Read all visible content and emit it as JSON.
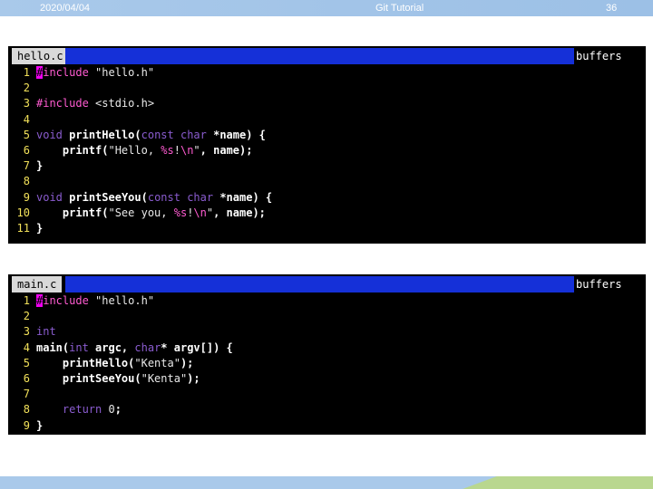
{
  "header": {
    "date": "2020/04/04",
    "title": "Git Tutorial",
    "page": "36"
  },
  "editors": [
    {
      "tab": "hello.c",
      "side": "buffers",
      "lines": [
        [
          {
            "t": "#",
            "c": "cursor"
          },
          {
            "t": "include",
            "c": "pp"
          },
          {
            "t": " \"hello.h\"",
            "c": "str"
          }
        ],
        [],
        [
          {
            "t": "#include",
            "c": "pp"
          },
          {
            "t": " <stdio.h>",
            "c": "str"
          }
        ],
        [],
        [
          {
            "t": "void",
            "c": "ty"
          },
          {
            "t": " ",
            "c": ""
          },
          {
            "t": "printHello",
            "c": "fn"
          },
          {
            "t": "(",
            "c": "fn"
          },
          {
            "t": "const char",
            "c": "ty"
          },
          {
            "t": " *name) {",
            "c": "fn"
          }
        ],
        [
          {
            "t": "    printf(",
            "c": "fn"
          },
          {
            "t": "\"Hello, ",
            "c": "str"
          },
          {
            "t": "%s",
            "c": "pp"
          },
          {
            "t": "!",
            "c": "str"
          },
          {
            "t": "\\n",
            "c": "pp"
          },
          {
            "t": "\"",
            "c": "str"
          },
          {
            "t": ", name);",
            "c": "fn"
          }
        ],
        [
          {
            "t": "}",
            "c": "fn"
          }
        ],
        [],
        [
          {
            "t": "void",
            "c": "ty"
          },
          {
            "t": " ",
            "c": ""
          },
          {
            "t": "printSeeYou",
            "c": "fn"
          },
          {
            "t": "(",
            "c": "fn"
          },
          {
            "t": "const char",
            "c": "ty"
          },
          {
            "t": " *name) {",
            "c": "fn"
          }
        ],
        [
          {
            "t": "    printf(",
            "c": "fn"
          },
          {
            "t": "\"See you, ",
            "c": "str"
          },
          {
            "t": "%s",
            "c": "pp"
          },
          {
            "t": "!",
            "c": "str"
          },
          {
            "t": "\\n",
            "c": "pp"
          },
          {
            "t": "\"",
            "c": "str"
          },
          {
            "t": ", name);",
            "c": "fn"
          }
        ],
        [
          {
            "t": "}",
            "c": "fn"
          }
        ]
      ]
    },
    {
      "tab": "main.c",
      "side": "buffers",
      "lines": [
        [
          {
            "t": "#",
            "c": "cursor"
          },
          {
            "t": "include",
            "c": "pp"
          },
          {
            "t": " \"hello.h\"",
            "c": "str"
          }
        ],
        [],
        [
          {
            "t": "int",
            "c": "ty"
          }
        ],
        [
          {
            "t": "main(",
            "c": "fn"
          },
          {
            "t": "int",
            "c": "ty"
          },
          {
            "t": " argc, ",
            "c": "fn"
          },
          {
            "t": "char",
            "c": "ty"
          },
          {
            "t": "* argv[]) {",
            "c": "fn"
          }
        ],
        [
          {
            "t": "    printHello(",
            "c": "fn"
          },
          {
            "t": "\"Kenta\"",
            "c": "str"
          },
          {
            "t": ");",
            "c": "fn"
          }
        ],
        [
          {
            "t": "    printSeeYou(",
            "c": "fn"
          },
          {
            "t": "\"Kenta\"",
            "c": "str"
          },
          {
            "t": ");",
            "c": "fn"
          }
        ],
        [],
        [
          {
            "t": "    ",
            "c": ""
          },
          {
            "t": "return",
            "c": "kw"
          },
          {
            "t": " ",
            "c": ""
          },
          {
            "t": "0",
            "c": "num"
          },
          {
            "t": ";",
            "c": "fn"
          }
        ],
        [
          {
            "t": "}",
            "c": "fn"
          }
        ]
      ]
    }
  ]
}
